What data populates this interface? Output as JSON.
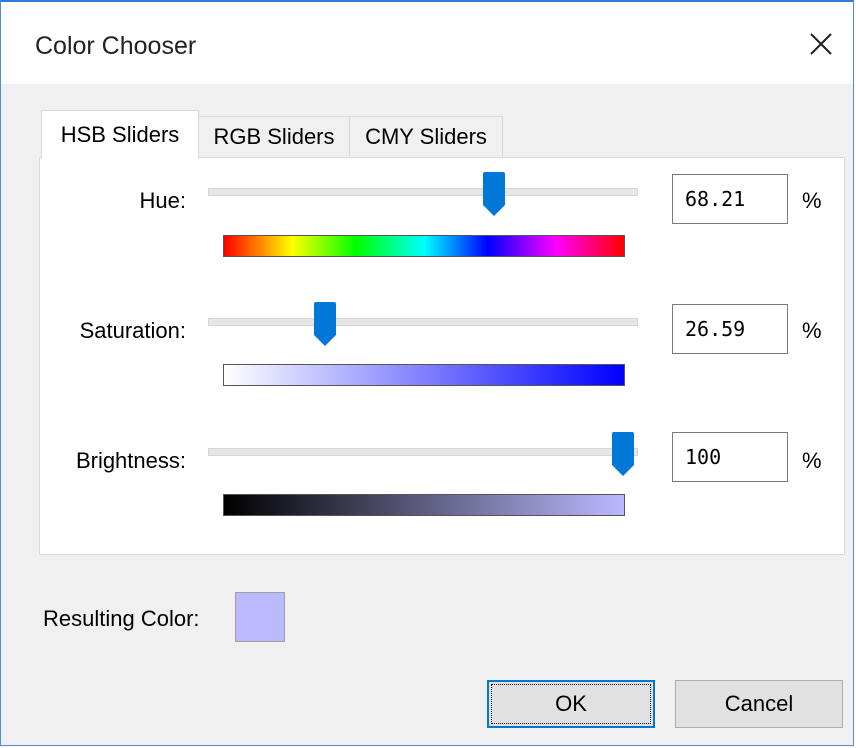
{
  "window": {
    "title": "Color Chooser"
  },
  "tabs": [
    {
      "label": "HSB Sliders",
      "active": true
    },
    {
      "label": "RGB Sliders",
      "active": false
    },
    {
      "label": "CMY Sliders",
      "active": false
    }
  ],
  "sliders": [
    {
      "label": "Hue:",
      "value": "68.21",
      "unit": "%",
      "level": 0.6821,
      "gradient": "hue-spectrum"
    },
    {
      "label": "Saturation:",
      "value": "26.59",
      "unit": "%",
      "level": 0.2659,
      "gradient": "white-to-blue"
    },
    {
      "label": "Brightness:",
      "value": "100",
      "unit": "%",
      "level": 1.0,
      "gradient": "black-to-lavender"
    }
  ],
  "result": {
    "label": "Resulting Color:",
    "color": "#bbb9ff"
  },
  "buttons": {
    "ok": "OK",
    "cancel": "Cancel"
  },
  "icons": {
    "close": "close-icon",
    "thumb": "slider-thumb-icon"
  },
  "colors": {
    "accent": "#0078d7",
    "window_border": "#2e7bd1"
  }
}
